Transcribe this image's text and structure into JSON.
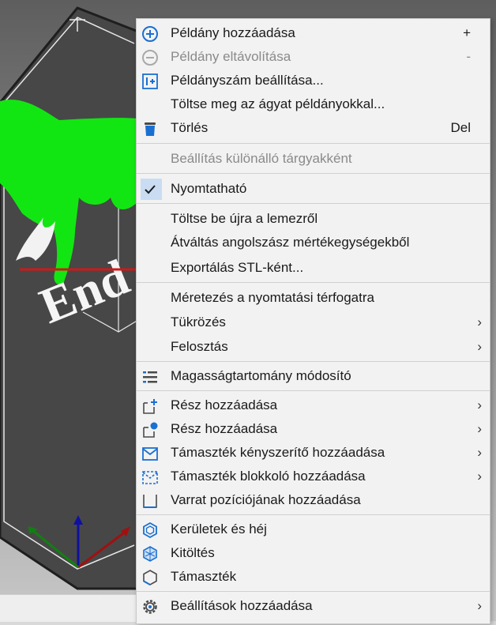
{
  "scene": {
    "model_text": "End"
  },
  "colors": {
    "accent_blue": "#1a6fd1",
    "model_green": "#12e612",
    "bed": "#4a4a4a",
    "arrow_red": "#d01818"
  },
  "menu": {
    "items": [
      {
        "label": "Példány hozzáadása",
        "shortcut": "+",
        "icon": "plus-circle-icon"
      },
      {
        "label": "Példány eltávolítása",
        "shortcut": "-",
        "icon": "minus-circle-icon",
        "disabled": true
      },
      {
        "label": "Példányszám beállítása...",
        "icon": "instance-count-icon"
      },
      {
        "label": "Töltse meg az ágyat példányokkal..."
      },
      {
        "label": "Törlés",
        "shortcut": "Del",
        "icon": "trash-icon"
      },
      {
        "label": "Beállítás különálló tárgyakként",
        "disabled": true
      },
      {
        "label": "Nyomtatható",
        "checked": true,
        "icon": "checkmark-icon"
      },
      {
        "label": "Töltse be újra a lemezről"
      },
      {
        "label": "Átváltás angolszász mértékegységekből"
      },
      {
        "label": "Exportálás STL-ként..."
      },
      {
        "label": "Méretezés a nyomtatási térfogatra"
      },
      {
        "label": "Tükrözés",
        "submenu": true
      },
      {
        "label": "Felosztás",
        "submenu": true
      },
      {
        "label": "Magasságtartomány módosító",
        "icon": "height-range-icon"
      },
      {
        "label": "Rész hozzáadása",
        "submenu": true,
        "icon": "add-part-icon"
      },
      {
        "label": "Rész hozzáadása",
        "submenu": true,
        "icon": "add-negative-part-icon"
      },
      {
        "label": "Támaszték kényszerítő hozzáadása",
        "submenu": true,
        "icon": "support-enforcer-icon"
      },
      {
        "label": "Támaszték blokkoló hozzáadása",
        "submenu": true,
        "icon": "support-blocker-icon"
      },
      {
        "label": "Varrat pozíciójának hozzáadása",
        "icon": "seam-icon"
      },
      {
        "label": "Kerületek és héj",
        "icon": "perimeters-icon"
      },
      {
        "label": "Kitöltés",
        "icon": "infill-icon"
      },
      {
        "label": "Támaszték",
        "icon": "support-icon"
      },
      {
        "label": "Beállítások hozzáadása",
        "submenu": true,
        "icon": "gear-icon"
      }
    ],
    "arrow_glyph": "›"
  }
}
